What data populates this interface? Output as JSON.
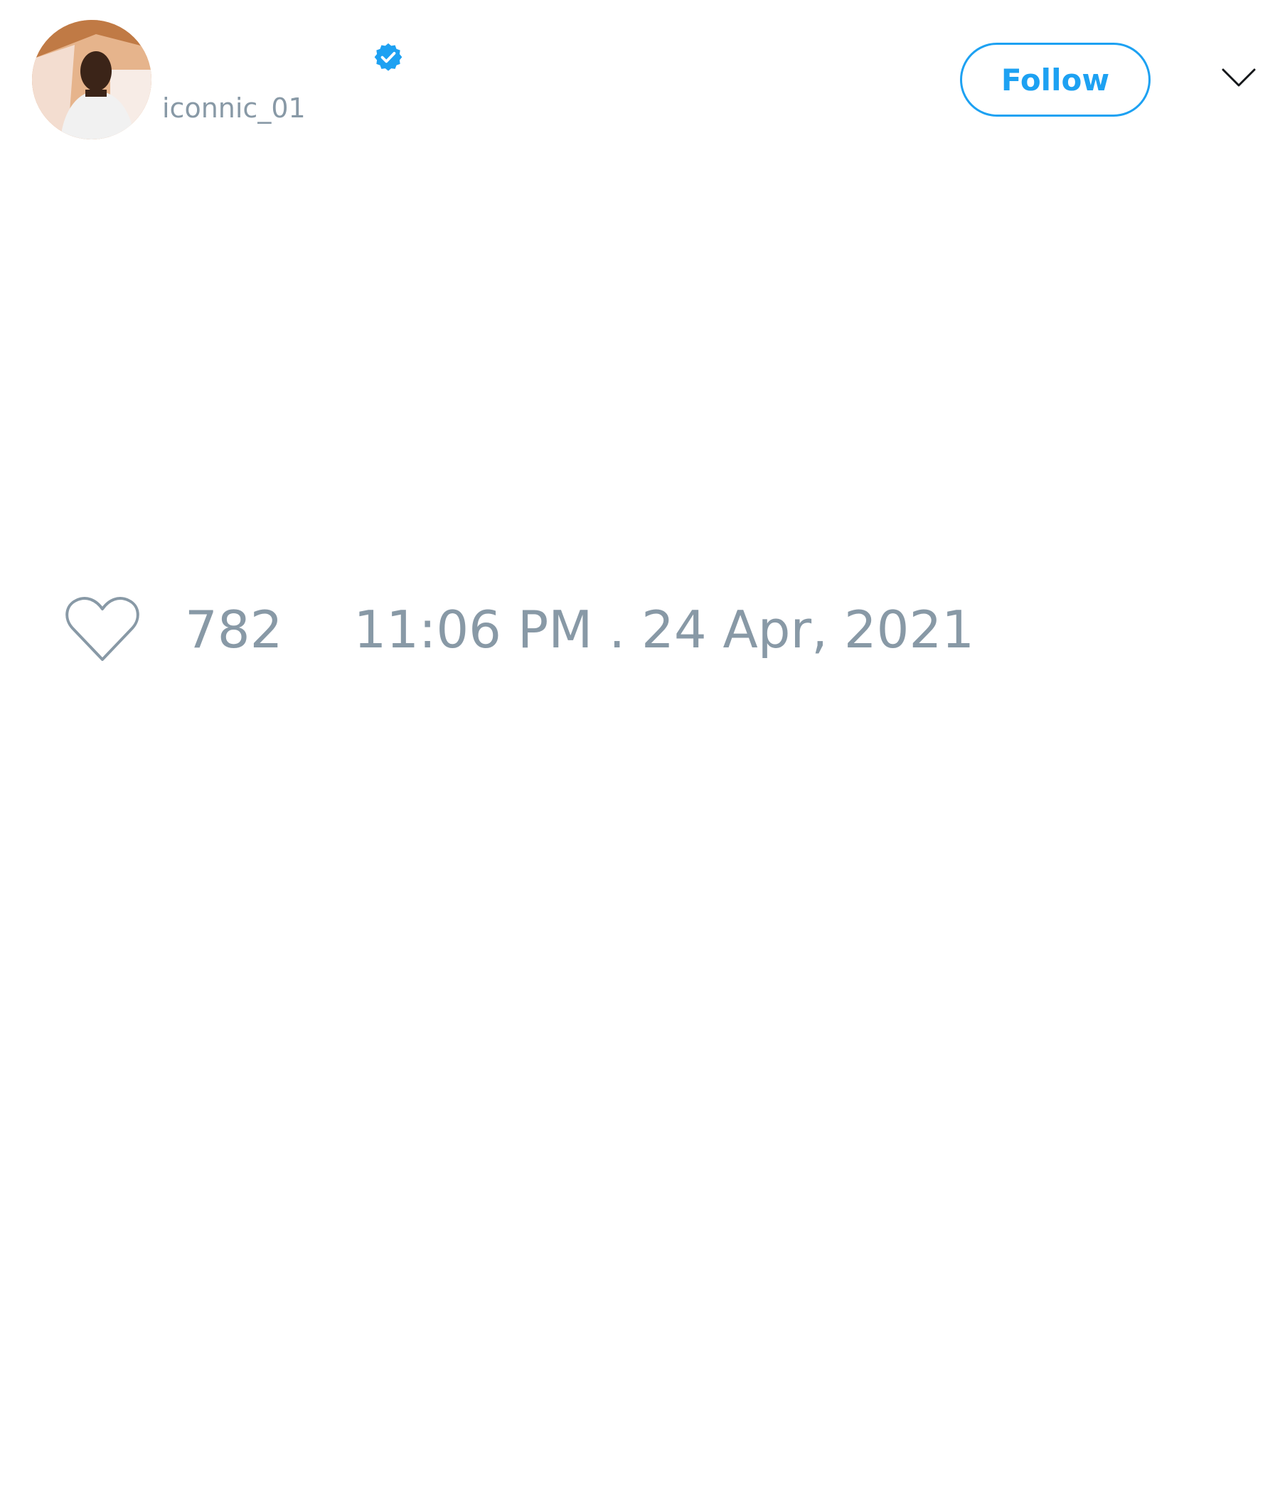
{
  "tweet": {
    "author": {
      "display_name": "",
      "handle": "iconnic_01",
      "verified": true,
      "avatar_icon": "user-avatar-photo"
    },
    "follow_label": "Follow",
    "menu_icon": "chevron-down-icon",
    "like_icon": "heart-icon",
    "like_count": "782",
    "timestamp": "11:06 PM . 24 Apr, 2021"
  },
  "colors": {
    "accent": "#1da1f2",
    "muted_text": "#8899a6",
    "background": "#ffffff"
  }
}
